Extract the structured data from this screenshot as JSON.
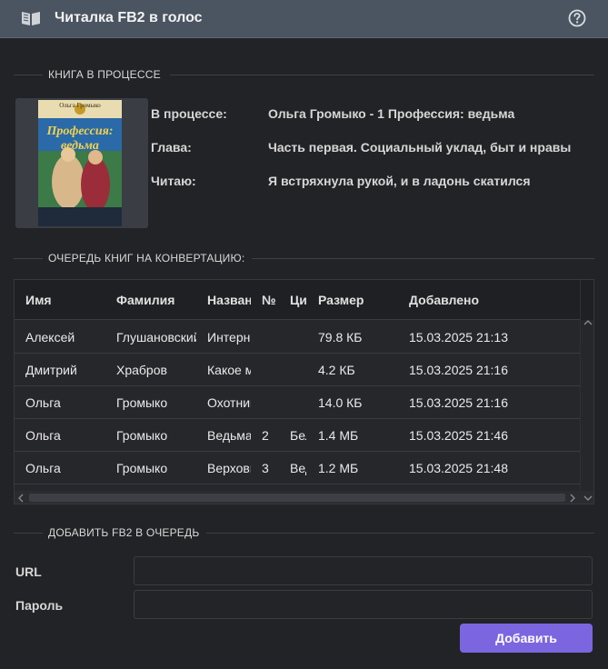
{
  "app": {
    "title": "Читалка FB2 в голос",
    "icons": {
      "app": "book-open-icon",
      "help": "help-circle-icon"
    }
  },
  "current": {
    "legend": "КНИГА В ПРОЦЕССЕ",
    "cover": {
      "author": "Ольга Громыко",
      "title_line1": "Профессия:",
      "title_line2": "ведьма"
    },
    "rows": [
      {
        "label": "В процессе:",
        "value": "Ольга Громыко - 1 Профессия: ведьма"
      },
      {
        "label": "Глава:",
        "value": "Часть первая. Социальный уклад, быт и нравы"
      },
      {
        "label": "Читаю:",
        "value": "Я встряхнула рукой, и в ладонь скатился"
      }
    ]
  },
  "queue": {
    "legend": "ОЧЕРЕДЬ КНИГ НА КОНВЕРТАЦИЮ:",
    "columns": [
      "Имя",
      "Фамилия",
      "Название",
      "№",
      "Цикл",
      "Размер",
      "Добавлено"
    ],
    "rows": [
      [
        "Алексей",
        "Глушановский",
        "Интернет",
        "",
        "",
        "79.8 КБ",
        "15.03.2025 21:13"
      ],
      [
        "Дмитрий",
        "Храбров",
        "Какое место",
        "",
        "",
        "4.2 КБ",
        "15.03.2025 21:16"
      ],
      [
        "Ольга",
        "Громыко",
        "Охотники",
        "",
        "",
        "14.0 КБ",
        "15.03.2025 21:16"
      ],
      [
        "Ольга",
        "Громыко",
        "Ведьма",
        "2",
        "Белорская",
        "1.4 МБ",
        "15.03.2025 21:46"
      ],
      [
        "Ольга",
        "Громыко",
        "Верховная",
        "3",
        "Ведьма",
        "1.2 МБ",
        "15.03.2025 21:48"
      ]
    ]
  },
  "add_form": {
    "legend": "ДОБАВИТЬ FB2 В ОЧЕРЕДЬ",
    "url_label": "URL",
    "url_value": "",
    "password_label": "Пароль",
    "password_value": "",
    "submit_label": "Добавить"
  },
  "colors": {
    "titlebar": "#4b5561",
    "background": "#222326",
    "accent": "#7c66e0"
  }
}
